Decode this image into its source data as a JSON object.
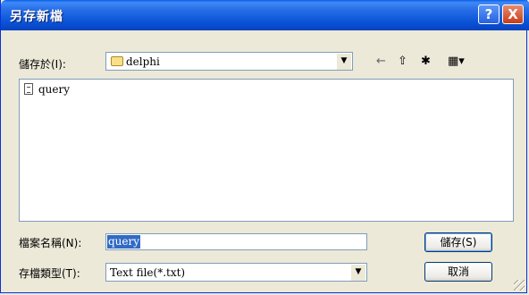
{
  "window": {
    "title": "另存新檔",
    "help_label": "?",
    "close_label": "X"
  },
  "save_in": {
    "label": "儲存於(I):",
    "value": "delphi"
  },
  "toolbar": {
    "back_icon": "←",
    "up_icon": "⇧",
    "new_folder_icon": "✱",
    "views_icon": "▦▾"
  },
  "files": [
    {
      "name": "query",
      "icon": "text-file-icon"
    }
  ],
  "filename": {
    "label": "檔案名稱(N):",
    "value": "query"
  },
  "filetype": {
    "label": "存檔類型(T):",
    "value": "Text file(*.txt)"
  },
  "buttons": {
    "save": "儲存(S)",
    "cancel": "取消"
  },
  "colors": {
    "titlebar": "#0A55D8",
    "selection": "#316AC5",
    "dialog_bg": "#ECE9D8"
  }
}
